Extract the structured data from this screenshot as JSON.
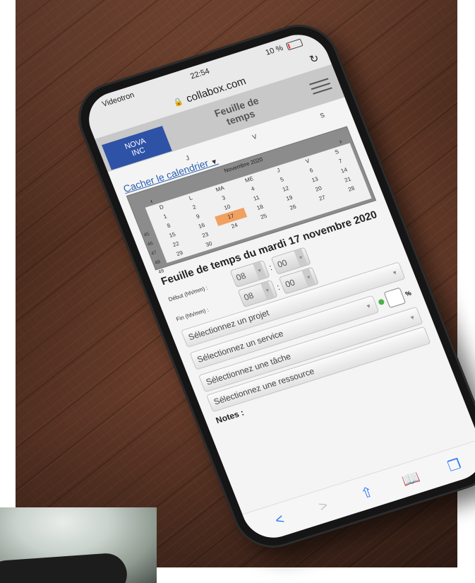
{
  "status": {
    "carrier": "Videotron",
    "time": "22:54",
    "battery": "10 %"
  },
  "browser": {
    "url": "collabox.com"
  },
  "app": {
    "brand_line1": "NOVA",
    "brand_line2": "INC",
    "title_line1": "Feuille de",
    "title_line2": "temps"
  },
  "calendar": {
    "toggle_label": "Cacher le calendrier",
    "month_title": "Novembre 2020",
    "prev": "‹",
    "next": "›",
    "top_days": [
      "J",
      "V",
      "S"
    ],
    "weekdays": [
      "D",
      "L",
      "MA",
      "ME",
      "J",
      "V",
      "S"
    ],
    "weeks": [
      "45",
      "46",
      "47",
      "48",
      "49"
    ],
    "days": [
      "1",
      "2",
      "3",
      "4",
      "5",
      "6",
      "7",
      "8",
      "9",
      "10",
      "11",
      "12",
      "13",
      "14",
      "15",
      "16",
      "17",
      "18",
      "19",
      "20",
      "21",
      "22",
      "23",
      "24",
      "25",
      "26",
      "27",
      "28",
      "29",
      "30"
    ],
    "selected_day": "17"
  },
  "form": {
    "heading": "Feuille de temps du mardi 17 novembre 2020",
    "start_label": "Début",
    "end_label": "Fin",
    "unit_hint": "(hh/mm) :",
    "start_hour": "08",
    "start_minute": "00",
    "end_hour": "08",
    "end_minute": "00",
    "project_placeholder": "Sélectionnez un projet",
    "service_placeholder": "Sélectionnez un service",
    "task_placeholder": "Sélectionnez une tâche",
    "resource_placeholder": "Sélectionnez une ressource",
    "percent_symbol": "%",
    "notes_label": "Notes :"
  },
  "toolbar": {
    "back": "<",
    "forward": ">"
  }
}
